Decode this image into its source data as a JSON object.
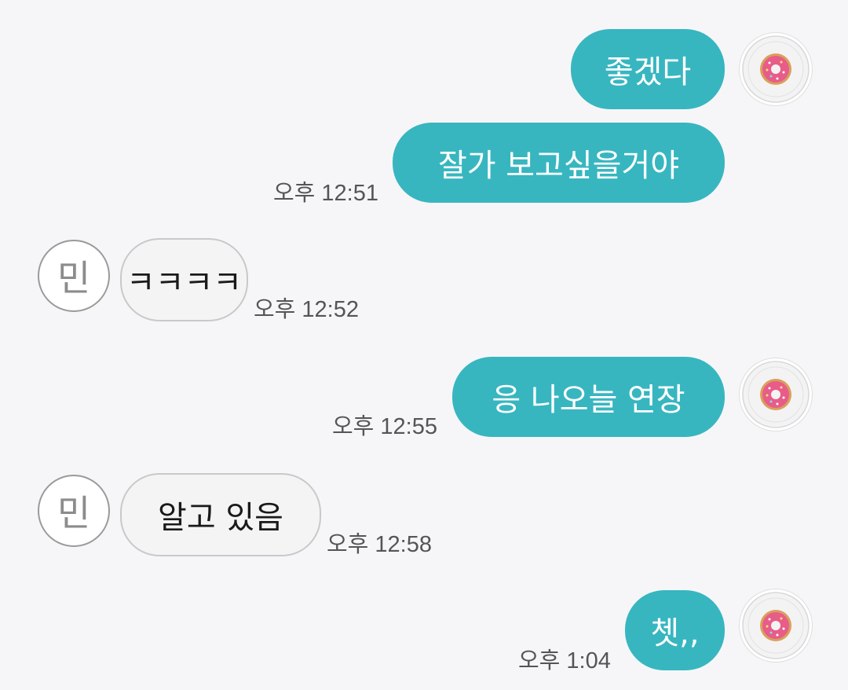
{
  "colors": {
    "outgoing_bubble": "#37b6c0",
    "incoming_bubble": "#f4f4f4",
    "background": "#f6f6f8"
  },
  "friend": {
    "avatar_initial": "민"
  },
  "me": {
    "avatar_icon": "donut-icon"
  },
  "messages": [
    {
      "direction": "out",
      "text": "좋겠다",
      "time": ""
    },
    {
      "direction": "out",
      "text": "잘가 보고싶을거야",
      "time": "오후 12:51"
    },
    {
      "direction": "in",
      "text": "ㅋㅋㅋㅋ",
      "time": "오후 12:52"
    },
    {
      "direction": "out",
      "text": "응 나오늘 연장",
      "time": "오후 12:55"
    },
    {
      "direction": "in",
      "text": "알고 있음",
      "time": "오후 12:58"
    },
    {
      "direction": "out",
      "text": "쳇,,",
      "time": "오후 1:04"
    }
  ]
}
